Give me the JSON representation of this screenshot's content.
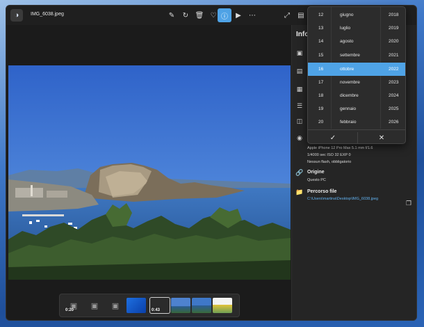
{
  "window": {
    "file_name": "IMG_6038.jpeg"
  },
  "toolbar": {
    "icons": [
      "edit-icon",
      "rotate-icon",
      "delete-icon",
      "favorite-icon",
      "info-icon",
      "slideshow-icon",
      "more-icon",
      "fullscreen-icon",
      "panel-icon"
    ],
    "active": "info-icon"
  },
  "info_panel": {
    "title": "Info",
    "camera_line": "Apple     iPhone 12 Pro Max     5.1 mm     f/1.6",
    "exposure_line": "1/4000 sec     ISO 32     EXP 0",
    "flash_line": "Nessun flash, obbligatorio",
    "origin_label": "Origine",
    "origin_value": "Questo PC",
    "path_label": "Percorso file",
    "path_value": "C:\\Users\\martina\\Desktop\\IMG_6038.jpeg"
  },
  "date_picker": {
    "rows": [
      {
        "day": "12",
        "month": "giugno",
        "year": "2018"
      },
      {
        "day": "13",
        "month": "luglio",
        "year": "2019"
      },
      {
        "day": "14",
        "month": "agosto",
        "year": "2020"
      },
      {
        "day": "15",
        "month": "settembre",
        "year": "2021"
      },
      {
        "day": "16",
        "month": "ottobre",
        "year": "2022"
      },
      {
        "day": "17",
        "month": "novembre",
        "year": "2023"
      },
      {
        "day": "18",
        "month": "dicembre",
        "year": "2024"
      },
      {
        "day": "19",
        "month": "gennaio",
        "year": "2025"
      },
      {
        "day": "20",
        "month": "febbraio",
        "year": "2026"
      }
    ],
    "selected_index": 4,
    "confirm_icon": "checkmark-icon",
    "cancel_icon": "close-icon"
  },
  "filmstrip": {
    "thumbs": [
      {
        "kind": "video-placeholder",
        "duration": "0:20"
      },
      {
        "kind": "image-placeholder",
        "duration": ""
      },
      {
        "kind": "image-placeholder",
        "duration": ""
      },
      {
        "kind": "blue-screen",
        "duration": ""
      },
      {
        "kind": "video-dark",
        "duration": "0:43"
      },
      {
        "kind": "sea-photo",
        "duration": ""
      },
      {
        "kind": "sea-photo",
        "duration": ""
      },
      {
        "kind": "bright-photo",
        "duration": ""
      }
    ]
  }
}
